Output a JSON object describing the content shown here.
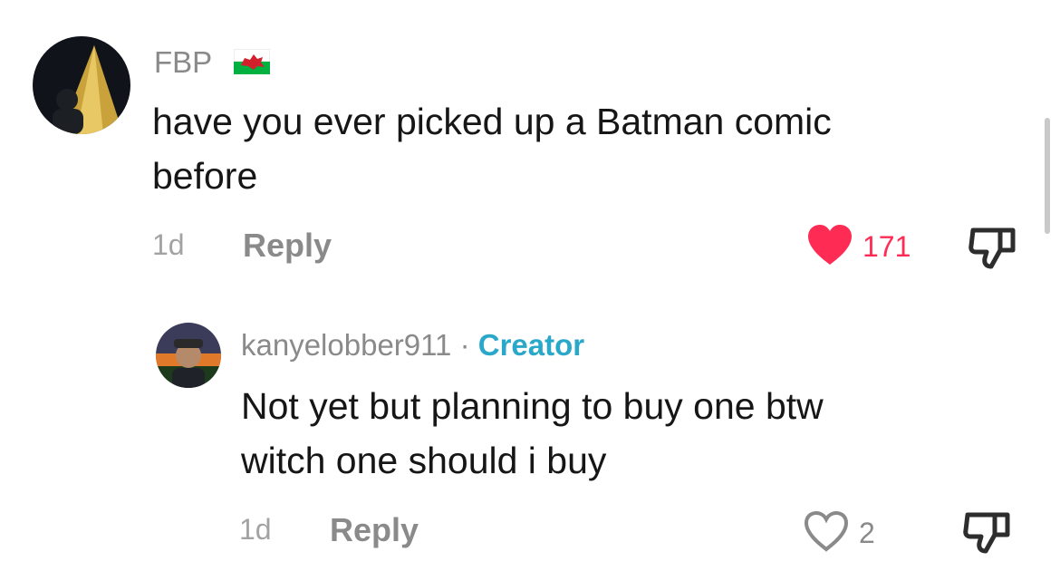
{
  "comments": [
    {
      "username": "FBP",
      "flag_icon": "wales-flag-icon",
      "text_line1": "have you ever picked up a Batman comic",
      "text_line2": "before",
      "time": "1d",
      "reply_label": "Reply",
      "likes": "171",
      "liked": true,
      "like_color": "#fe2c55"
    },
    {
      "username": "kanyelobber911",
      "separator": "·",
      "badge": "Creator",
      "badge_color": "#2aa8c9",
      "text_line1": "Not yet but planning to buy one btw",
      "text_line2": "witch one should i buy",
      "time": "1d",
      "reply_label": "Reply",
      "likes": "2",
      "liked": false
    }
  ]
}
